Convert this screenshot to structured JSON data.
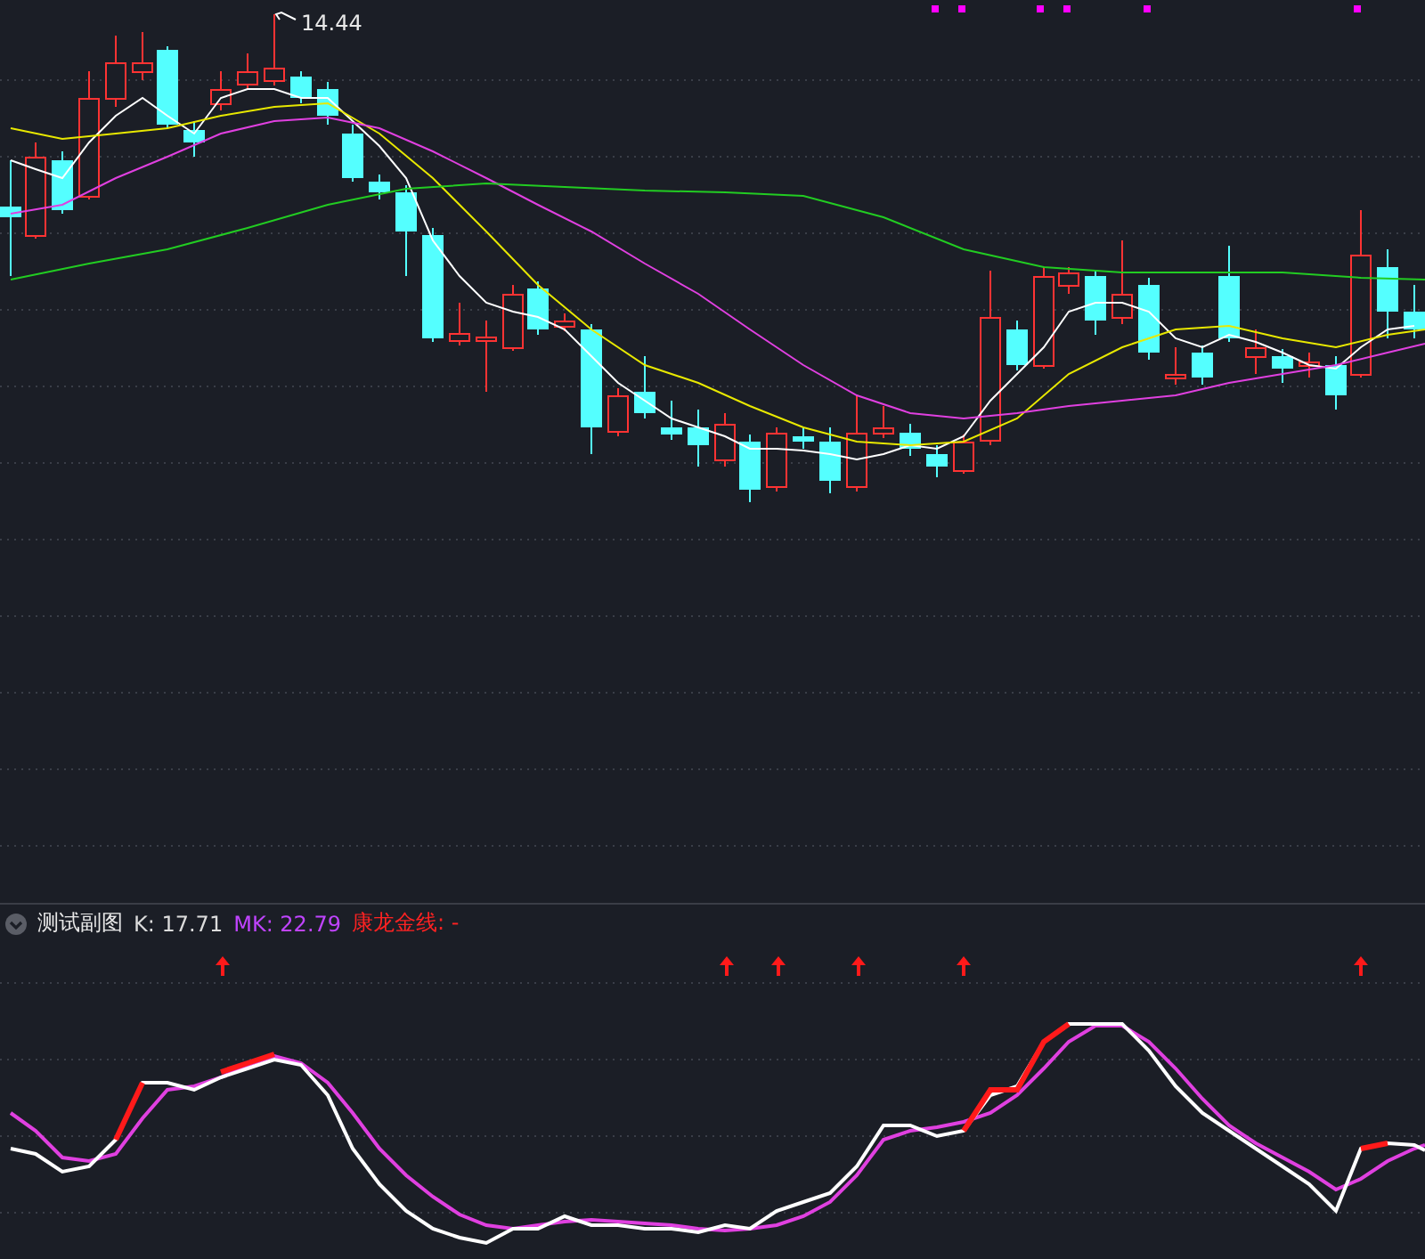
{
  "main_chart": {
    "high_label": "14.44"
  },
  "indicator": {
    "title": "测试副图",
    "expanded": true,
    "readings": [
      {
        "text": "K: 17.71",
        "color": "#dcdcdc"
      },
      {
        "text": "MK: 22.79",
        "color": "#c044ff"
      },
      {
        "text": "康龙金线: -",
        "color": "#ff2222"
      }
    ]
  }
}
